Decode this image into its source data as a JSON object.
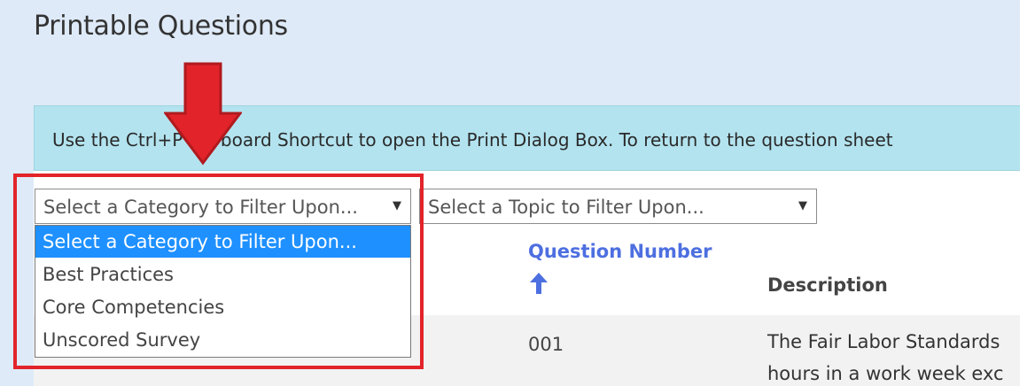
{
  "page": {
    "title": "Printable Questions",
    "info_text": "Use the Ctrl+P Keyboard Shortcut to open the Print Dialog Box. To return to the question sheet"
  },
  "filters": {
    "category": {
      "selected": "Select a Category to Filter Upon...",
      "options": [
        "Select a Category to Filter Upon...",
        "Best Practices",
        "Core Competencies",
        "Unscored Survey"
      ]
    },
    "topic": {
      "selected": "Select a Topic to Filter Upon..."
    }
  },
  "table": {
    "headers": {
      "question_number": "Question Number",
      "description": "Description"
    },
    "rows": [
      {
        "number": "001",
        "description_line1": "The Fair Labor Standards",
        "description_line2": "hours in a work week exc"
      }
    ]
  },
  "icons": {
    "sort": "arrow-up-icon",
    "caret": "caret-down-icon",
    "annotation": "arrow-down-icon"
  },
  "colors": {
    "accent": "#4d6fe0",
    "selected_option": "#1e90ff",
    "annotation": "#e2232a",
    "banner": "#b3e3ef"
  }
}
